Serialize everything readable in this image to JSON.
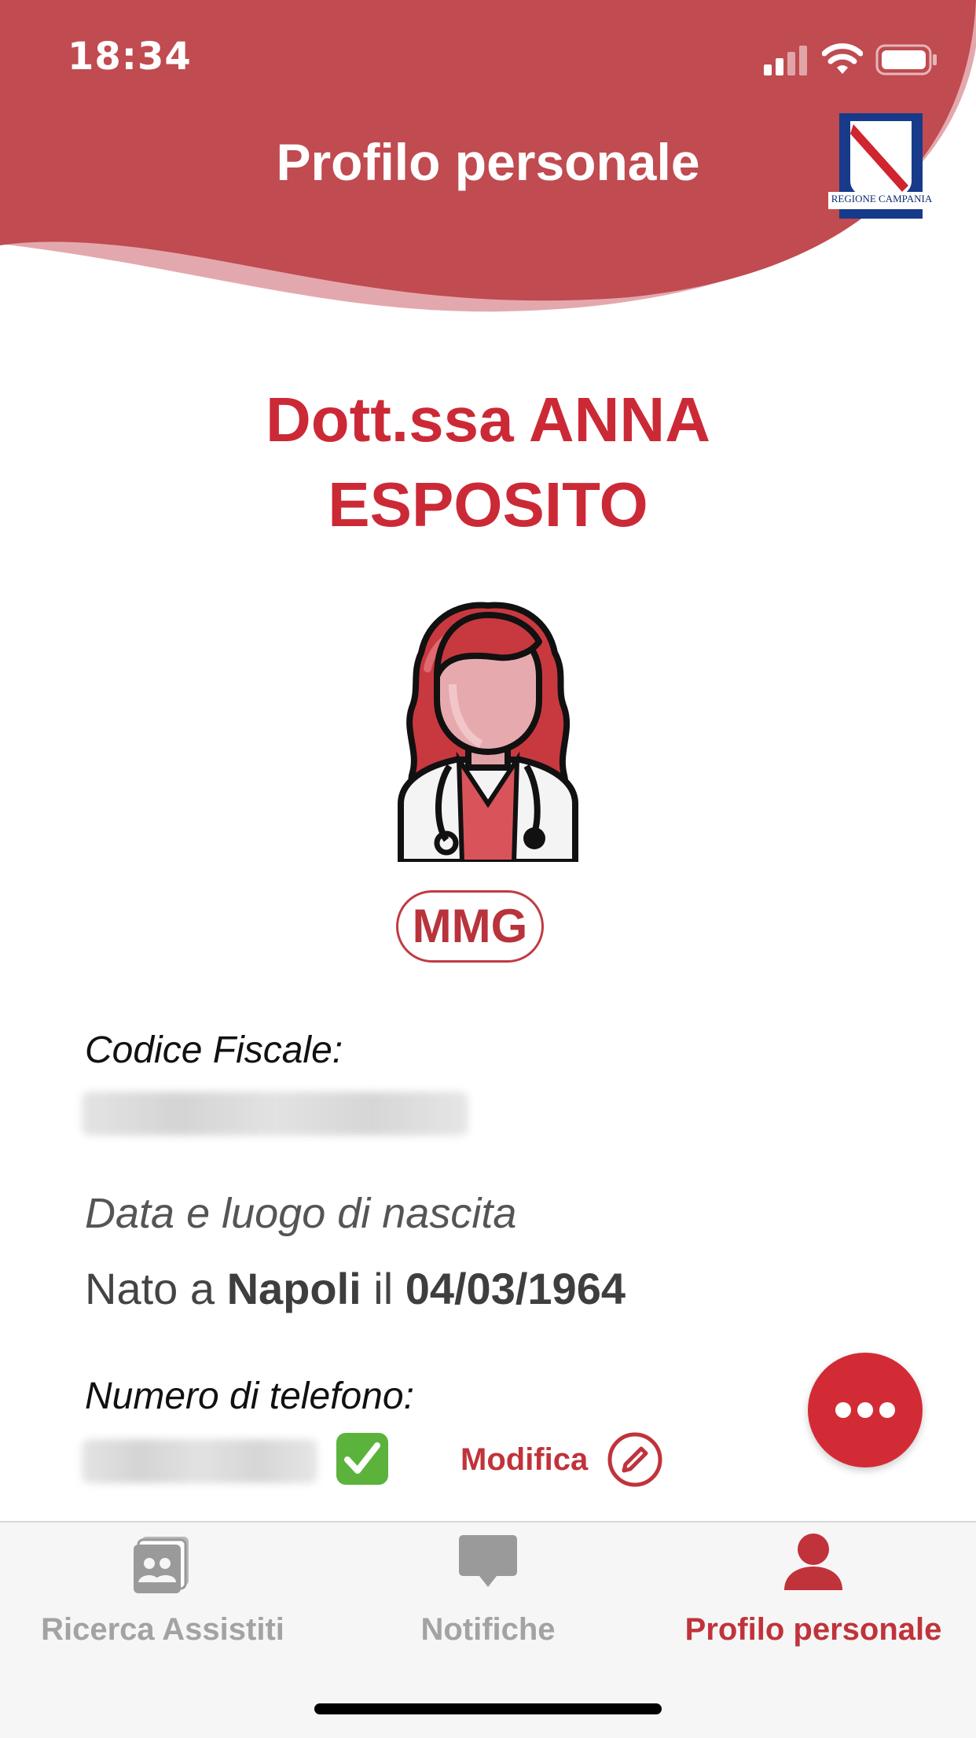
{
  "status_bar": {
    "time": "18:34",
    "icons": [
      "signal-icon",
      "wifi-icon",
      "battery-icon"
    ]
  },
  "header": {
    "title": "Profilo personale",
    "logo_label": "REGIONE CAMPANIA",
    "color": "#c04b50"
  },
  "profile": {
    "name_line1": "Dott.ssa ANNA",
    "name_line2": "ESPOSITO",
    "avatar": "doctor-avatar-icon",
    "role": "MMG",
    "accent_color": "#cc2936"
  },
  "fields": {
    "codice_fiscale_label": "Codice Fiscale:",
    "birth_label": "Data e luogo di nascita",
    "birth_prefix": "Nato a",
    "birth_place": "Napoli",
    "birth_mid": "il",
    "birth_date": "04/03/1964",
    "phone_label": "Numero di telefono:",
    "phone_verified_icon": "check-mark-icon",
    "edit_label": "Modifica",
    "edit_icon": "pencil-circle-icon"
  },
  "fab": {
    "icon": "more-dots-icon"
  },
  "tab_bar": {
    "tabs": [
      {
        "label": "Ricerca Assistiti",
        "icon": "contacts-icon",
        "active": false
      },
      {
        "label": "Notifiche",
        "icon": "chat-bubble-icon",
        "active": false
      },
      {
        "label": "Profilo personale",
        "icon": "person-icon",
        "active": true
      }
    ]
  }
}
